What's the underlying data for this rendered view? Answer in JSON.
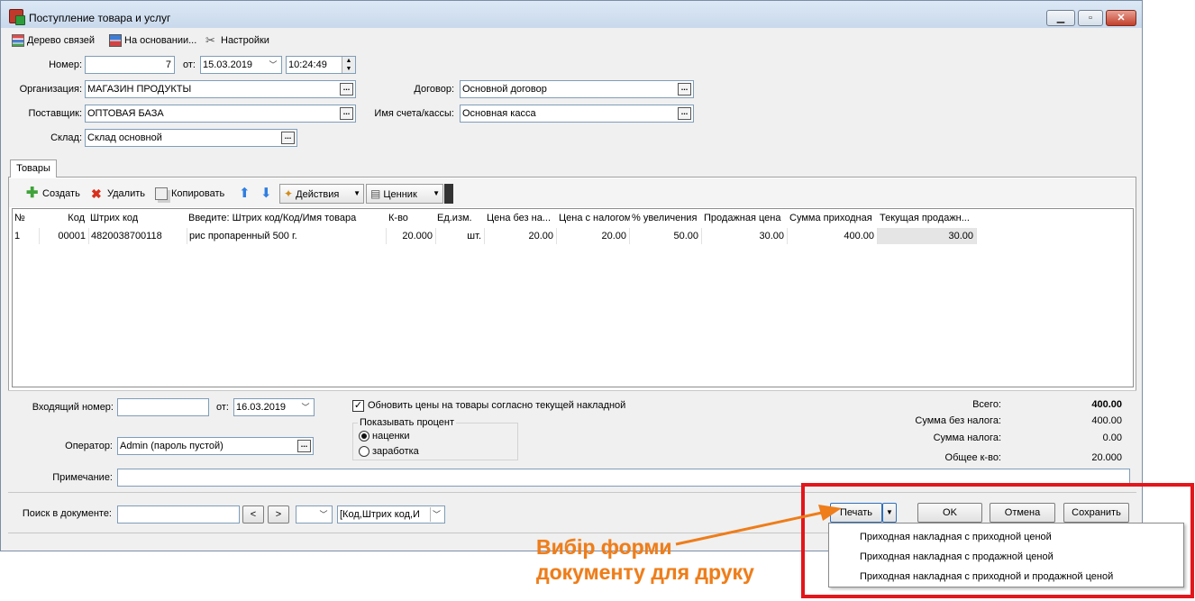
{
  "window": {
    "title": "Поступление товара и услуг"
  },
  "toolbar": {
    "tree_label": "Дерево связей",
    "based_on_label": "На основании...",
    "settings_label": "Настройки"
  },
  "header": {
    "number_label": "Номер:",
    "number_value": "7",
    "from_label": "от:",
    "date_value": "15.03.2019",
    "time_value": "10:24:49",
    "org_label": "Организация:",
    "org_value": "МАГАЗИН ПРОДУКТЫ",
    "supplier_label": "Поставщик:",
    "supplier_value": "ОПТОВАЯ БАЗА",
    "warehouse_label": "Склад:",
    "warehouse_value": "Склад основной",
    "contract_label": "Договор:",
    "contract_value": "Основной договор",
    "account_label": "Имя счета/кассы:",
    "account_value": "Основная касса"
  },
  "tabs": {
    "goods": "Товары"
  },
  "goods_toolbar": {
    "create": "Создать",
    "delete": "Удалить",
    "copy": "Копировать",
    "actions": "Действия",
    "price_tag": "Ценник"
  },
  "table": {
    "columns": [
      "№",
      "Код",
      "Штрих код",
      "Введите: Штрих код/Код/Имя товара",
      "К-во",
      "Ед.изм.",
      "Цена без на...",
      "Цена с налогом",
      "% увеличения",
      "Продажная цена",
      "Сумма приходная",
      "Текущая продажн..."
    ],
    "rows": [
      [
        "1",
        "00001",
        "4820038700118",
        "рис пропаренный 500 г.",
        "20.000",
        "шт.",
        "20.00",
        "20.00",
        "50.00",
        "30.00",
        "400.00",
        "30.00"
      ]
    ]
  },
  "footer": {
    "incoming_label": "Входящий номер:",
    "incoming_value": "",
    "from_label": "от:",
    "incoming_date": "16.03.2019",
    "operator_label": "Оператор:",
    "operator_value": "Admin (пароль пустой)",
    "note_label": "Примечание:",
    "note_value": "",
    "update_prices_label": "Обновить цены на товары согласно текущей накладной",
    "show_percent_label": "Показывать процент",
    "markup_label": "наценки",
    "margin_label": "заработка"
  },
  "totals": {
    "total_label": "Всего:",
    "total_value": "400.00",
    "without_tax_label": "Сумма без налога:",
    "without_tax_value": "400.00",
    "tax_label": "Сумма налога:",
    "tax_value": "0.00",
    "qty_label": "Общее к-во:",
    "qty_value": "20.000"
  },
  "search": {
    "label": "Поиск в документе:",
    "value": "",
    "prev": "<",
    "next": ">",
    "fields_value": "[Код,Штрих код,И"
  },
  "actions": {
    "print": "Печать",
    "ok": "OK",
    "cancel": "Отмена",
    "save": "Сохранить"
  },
  "print_menu": [
    "Приходная накладная с приходной ценой",
    "Приходная накладная с продажной ценой",
    "Приходная накладная с приходной и продажной ценой"
  ],
  "callout": {
    "line1": "Вибір форми",
    "line2": "документу для друку"
  },
  "colors": {
    "highlight_box": "#e3161b",
    "callout": "#ee7d1a"
  }
}
